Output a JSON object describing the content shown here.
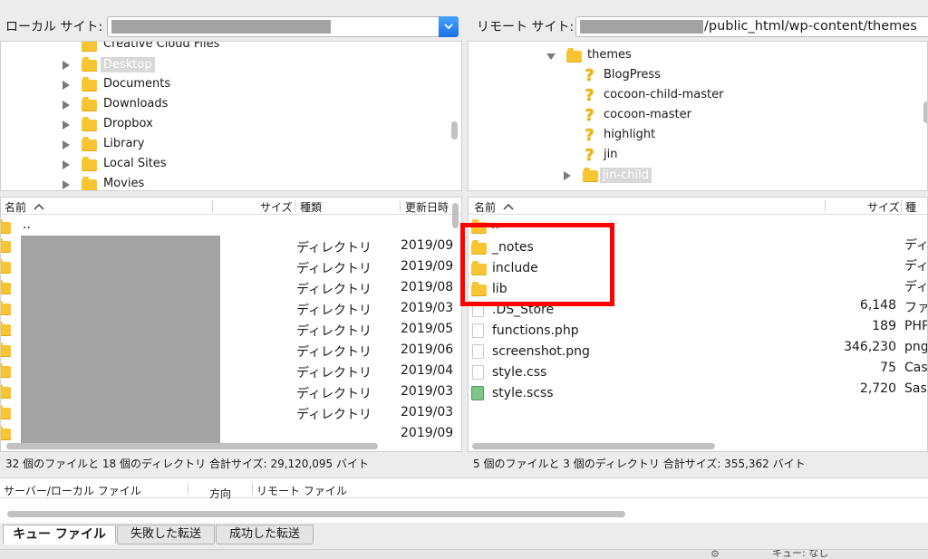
{
  "local": {
    "site_label": "ローカル サイト:",
    "tree": [
      {
        "label": "Creative Cloud Files",
        "expandable": false,
        "selected": false
      },
      {
        "label": "Desktop",
        "expandable": true,
        "selected": true
      },
      {
        "label": "Documents",
        "expandable": true,
        "selected": false
      },
      {
        "label": "Downloads",
        "expandable": true,
        "selected": false
      },
      {
        "label": "Dropbox",
        "expandable": true,
        "selected": false
      },
      {
        "label": "Library",
        "expandable": true,
        "selected": false
      },
      {
        "label": "Local Sites",
        "expandable": true,
        "selected": false
      },
      {
        "label": "Movies",
        "expandable": true,
        "selected": false
      }
    ],
    "columns": {
      "name": "名前",
      "size": "サイズ",
      "type": "種類",
      "modified": "更新日時"
    },
    "parent_entry": "..",
    "rows": [
      {
        "type": "ディレクトリ",
        "modified": "2019/09"
      },
      {
        "type": "ディレクトリ",
        "modified": "2019/09"
      },
      {
        "type": "ディレクトリ",
        "modified": "2019/08"
      },
      {
        "type": "ディレクトリ",
        "modified": "2019/03"
      },
      {
        "type": "ディレクトリ",
        "modified": "2019/05"
      },
      {
        "type": "ディレクトリ",
        "modified": "2019/06"
      },
      {
        "type": "ディレクトリ",
        "modified": "2019/04"
      },
      {
        "type": "ディレクトリ",
        "modified": "2019/03"
      },
      {
        "type": "ディレクトリ",
        "modified": "2019/03"
      },
      {
        "type": "",
        "modified": "2019/09"
      }
    ],
    "status": "32 個のファイルと 18 個のディレクトリ 合計サイズ: 29,120,095 バイト"
  },
  "remote": {
    "site_label": "リモート サイト:",
    "path_suffix": "/public_html/wp-content/themes",
    "tree": [
      {
        "label": "themes",
        "icon": "folder",
        "expanded": true
      },
      {
        "label": "BlogPress",
        "icon": "question"
      },
      {
        "label": "cocoon-child-master",
        "icon": "question"
      },
      {
        "label": "cocoon-master",
        "icon": "question"
      },
      {
        "label": "highlight",
        "icon": "question"
      },
      {
        "label": "jin",
        "icon": "question"
      },
      {
        "label": "jin-child",
        "icon": "folder",
        "selected": true
      }
    ],
    "columns": {
      "name": "名前",
      "size": "サイズ",
      "type": "種"
    },
    "parent_entry": "..",
    "rows": [
      {
        "name": "_notes",
        "icon": "folder",
        "size": "",
        "type": "ディ"
      },
      {
        "name": "include",
        "icon": "folder",
        "size": "",
        "type": "ディ"
      },
      {
        "name": "lib",
        "icon": "folder",
        "size": "",
        "type": "ディ"
      },
      {
        "name": ".DS_Store",
        "icon": "file",
        "size": "6,148",
        "type": "ファ"
      },
      {
        "name": "functions.php",
        "icon": "file",
        "size": "189",
        "type": "PHP"
      },
      {
        "name": "screenshot.png",
        "icon": "file",
        "size": "346,230",
        "type": "png"
      },
      {
        "name": "style.css",
        "icon": "file",
        "size": "75",
        "type": "Cas"
      },
      {
        "name": "style.scss",
        "icon": "scss",
        "size": "2,720",
        "type": "Sas"
      }
    ],
    "status": "5 個のファイルと 3 個のディレクトリ 合計サイズ: 355,362 バイト"
  },
  "queue": {
    "col_server_local": "サーバー/ローカル ファイル",
    "col_direction": "方向",
    "col_remote": "リモート ファイル"
  },
  "tabs": [
    {
      "label": "キュー ファイル",
      "active": true
    },
    {
      "label": "失敗した転送",
      "active": false
    },
    {
      "label": "成功した転送",
      "active": false
    }
  ],
  "bottom_status": "キュー: なし",
  "colors": {
    "highlight": "#ff0000",
    "folder": "#f7c531",
    "accent": "#1a6fe8"
  }
}
